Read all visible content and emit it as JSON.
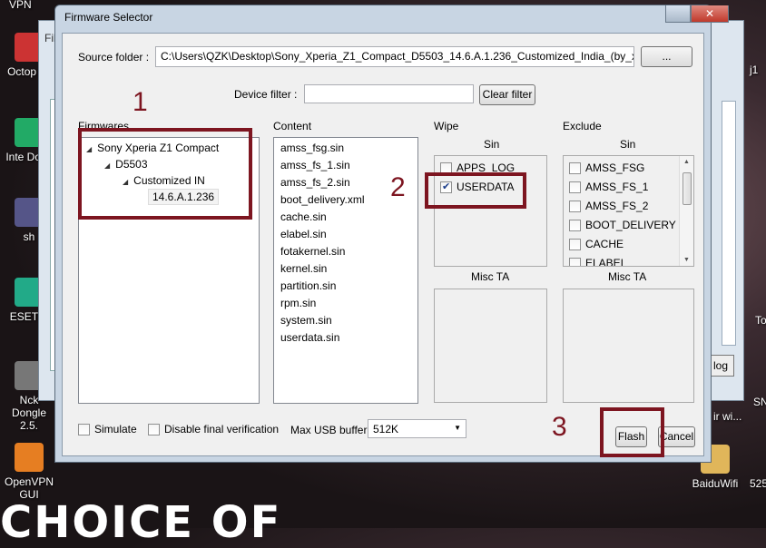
{
  "desktop": {
    "icons": [
      {
        "label": "Octop To",
        "color": "#c33"
      },
      {
        "label": "Inte Dowr",
        "color": "#2a6"
      },
      {
        "label": "sh",
        "color": "#558"
      },
      {
        "label": "ESET S",
        "color": "#2a8"
      },
      {
        "label": "Nck Dongle 2.5.",
        "color": "#777"
      },
      {
        "label": "OpenVPN GUI",
        "color": "#e67e22"
      }
    ],
    "top_left_text": "VPN",
    "right_labels": [
      "j1",
      "To",
      "SN",
      "ir wi..."
    ],
    "baidu_label": "BaiduWifi",
    "right_edge_text": "525",
    "wallpaper_text": "CHOICE OF"
  },
  "background_window": {
    "title_fragment": "Fil",
    "button_label": "log"
  },
  "dialog": {
    "title": "Firmware Selector",
    "close_glyph": "✕",
    "minimize_glyph": "",
    "source_folder_label": "Source folder :",
    "source_folder_value": "C:\\Users\\QZK\\Desktop\\Sony_Xperia_Z1_Compact_D5503_14.6.A.1.236_Customized_India_(by_xperia",
    "browse_label": "...",
    "device_filter_label": "Device filter :",
    "device_filter_value": "",
    "clear_filter_label": "Clear filter",
    "firmwares_label": "Firmwares",
    "firmware_tree": [
      "Sony Xperia Z1 Compact",
      "D5503",
      "Customized IN",
      "14.6.A.1.236"
    ],
    "content_label": "Content",
    "content_files": [
      "amss_fsg.sin",
      "amss_fs_1.sin",
      "amss_fs_2.sin",
      "boot_delivery.xml",
      "cache.sin",
      "elabel.sin",
      "fotakernel.sin",
      "kernel.sin",
      "partition.sin",
      "rpm.sin",
      "system.sin",
      "userdata.sin"
    ],
    "wipe_label": "Wipe",
    "wipe_sin_label": "Sin",
    "wipe_items": [
      {
        "label": "APPS_LOG",
        "checked": false
      },
      {
        "label": "USERDATA",
        "checked": true
      }
    ],
    "wipe_misc_label": "Misc TA",
    "exclude_label": "Exclude",
    "exclude_sin_label": "Sin",
    "exclude_items": [
      {
        "label": "AMSS_FSG",
        "checked": false
      },
      {
        "label": "AMSS_FS_1",
        "checked": false
      },
      {
        "label": "AMSS_FS_2",
        "checked": false
      },
      {
        "label": "BOOT_DELIVERY",
        "checked": false
      },
      {
        "label": "CACHE",
        "checked": false
      },
      {
        "label": "ELABEL",
        "checked": false
      }
    ],
    "exclude_misc_label": "Misc TA",
    "simulate_label": "Simulate",
    "simulate_checked": false,
    "disable_verification_label": "Disable final verification",
    "disable_verification_checked": false,
    "max_usb_label": "Max USB buffer",
    "max_usb_value": "512K",
    "flash_label": "Flash",
    "cancel_label": "Cancel"
  },
  "annotations": {
    "step1": "1",
    "step2": "2",
    "step3": "3",
    "color": "#7d1520"
  }
}
